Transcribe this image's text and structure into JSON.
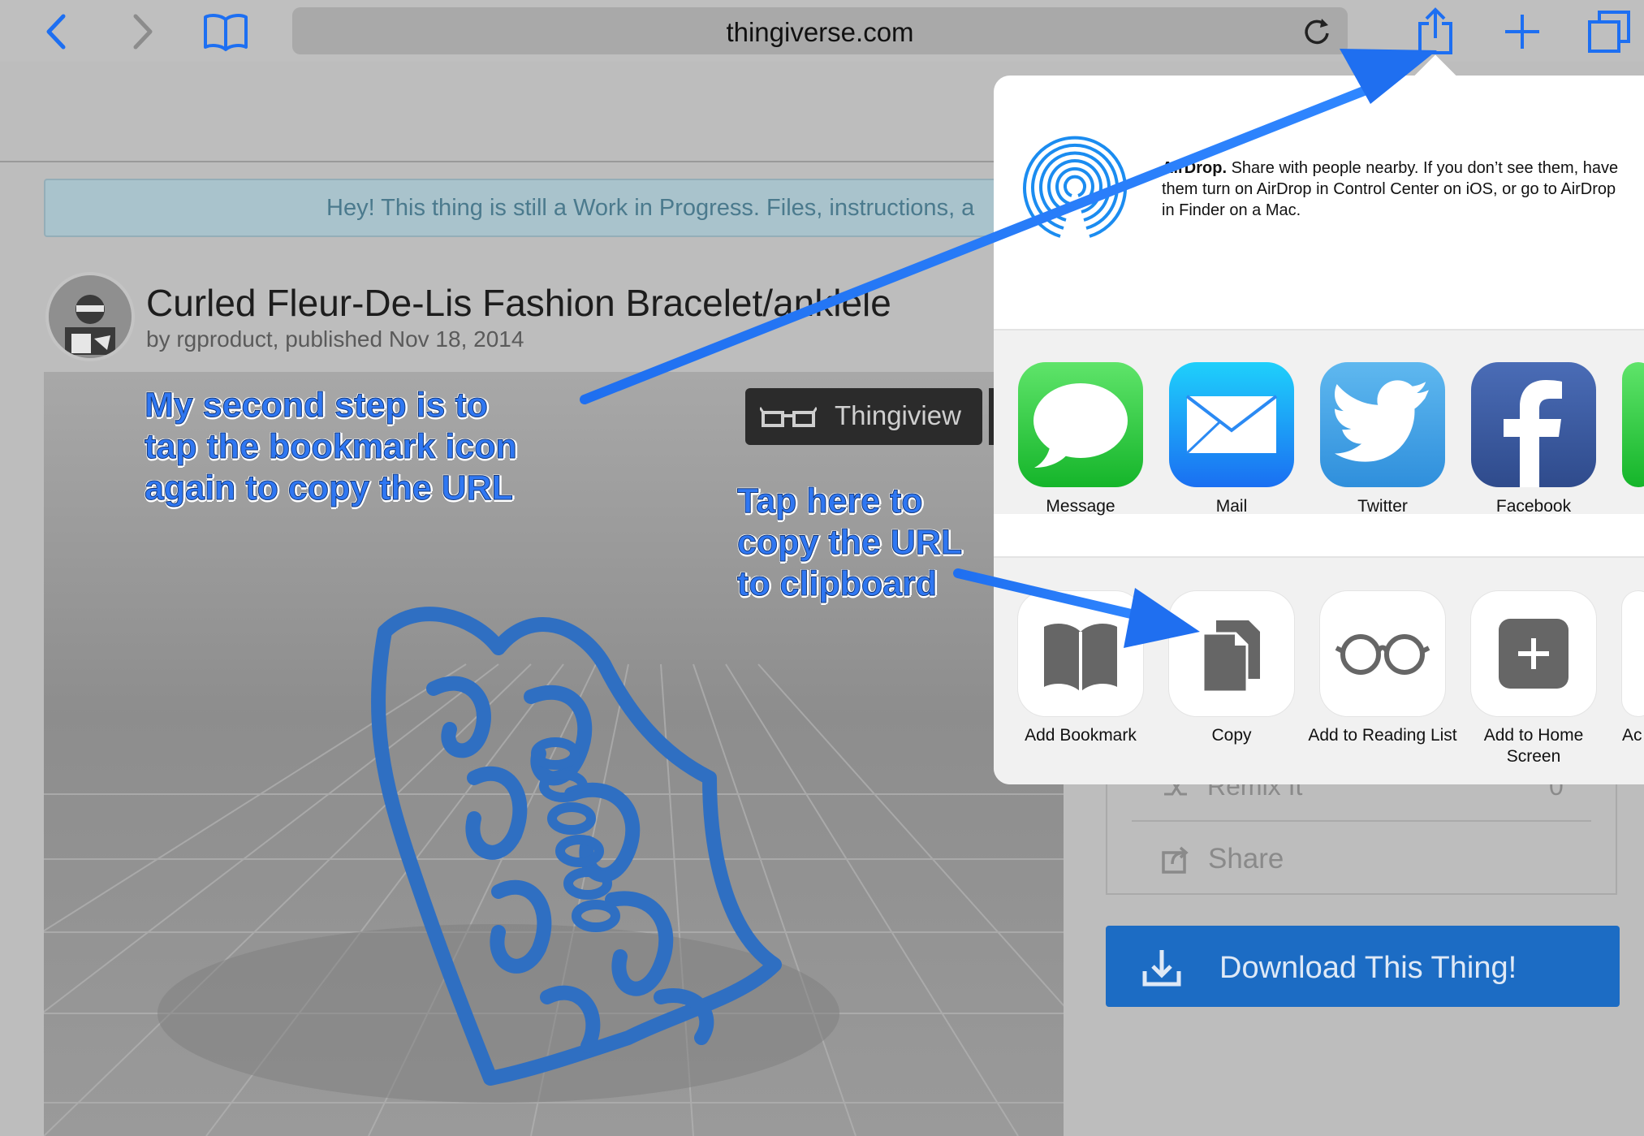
{
  "browser": {
    "url": "thingiverse.com"
  },
  "page": {
    "wip_banner": "Hey! This thing is still a Work in Progress. Files, instructions, a",
    "title": "Curled Fleur-De-Lis Fashion Bracelet/anklele",
    "byline": "by rgproduct, published Nov 18, 2014",
    "thingiview_label": "Thingiview",
    "side": {
      "remix_label": "Remix It",
      "remix_count": "0",
      "share_label": "Share",
      "download_label": "Download This Thing!"
    }
  },
  "share_sheet": {
    "airdrop_title": "AirDrop.",
    "airdrop_text": "Share with people nearby. If you don’t see them, have them turn on AirDrop in Control Center on iOS, or go to AirDrop in Finder on a Mac.",
    "apps": [
      {
        "label": "Message",
        "color": "#3ad24b"
      },
      {
        "label": "Mail",
        "color": "#1a8ff5"
      },
      {
        "label": "Twitter",
        "color": "#3ba2e8"
      },
      {
        "label": "Facebook",
        "color": "#3b5a9f"
      }
    ],
    "actions": [
      {
        "label": "Add Bookmark"
      },
      {
        "label": "Copy"
      },
      {
        "label": "Add to Reading List"
      },
      {
        "label": "Add to Home Screen"
      },
      {
        "label": "Ac"
      }
    ]
  },
  "annotations": {
    "step_note": "My second step is to tap the bookmark icon again to copy the URL",
    "copy_note": "Tap here to copy the URL to clipboard"
  },
  "colors": {
    "ios_blue": "#1d6ff2",
    "annotation_arrow": "#1f6ff0"
  }
}
